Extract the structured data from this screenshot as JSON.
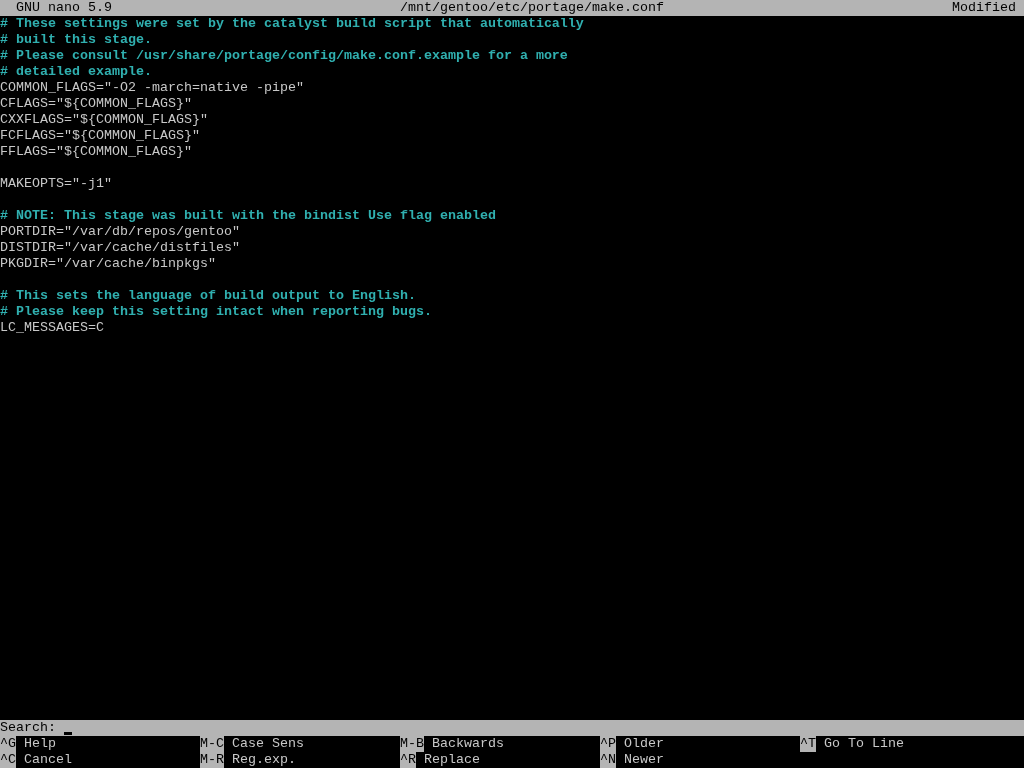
{
  "title_bar": {
    "app": "GNU nano 5.9",
    "file": "/mnt/gentoo/etc/portage/make.conf",
    "status": "Modified"
  },
  "lines": [
    {
      "kind": "comment",
      "text": "# These settings were set by the catalyst build script that automatically"
    },
    {
      "kind": "comment",
      "text": "# built this stage."
    },
    {
      "kind": "comment",
      "text": "# Please consult /usr/share/portage/config/make.conf.example for a more"
    },
    {
      "kind": "comment",
      "text": "# detailed example."
    },
    {
      "kind": "code",
      "text": "COMMON_FLAGS=\"-O2 -march=native -pipe\""
    },
    {
      "kind": "code",
      "text": "CFLAGS=\"${COMMON_FLAGS}\""
    },
    {
      "kind": "code",
      "text": "CXXFLAGS=\"${COMMON_FLAGS}\""
    },
    {
      "kind": "code",
      "text": "FCFLAGS=\"${COMMON_FLAGS}\""
    },
    {
      "kind": "code",
      "text": "FFLAGS=\"${COMMON_FLAGS}\""
    },
    {
      "kind": "blank"
    },
    {
      "kind": "code",
      "text": "MAKEOPTS=\"-j1\""
    },
    {
      "kind": "blank"
    },
    {
      "kind": "comment",
      "text": "# NOTE: This stage was built with the bindist Use flag enabled"
    },
    {
      "kind": "code",
      "text": "PORTDIR=\"/var/db/repos/gentoo\""
    },
    {
      "kind": "code",
      "text": "DISTDIR=\"/var/cache/distfiles\""
    },
    {
      "kind": "code",
      "text": "PKGDIR=\"/var/cache/binpkgs\""
    },
    {
      "kind": "blank"
    },
    {
      "kind": "comment",
      "text": "# This sets the language of build output to English."
    },
    {
      "kind": "comment",
      "text": "# Please keep this setting intact when reporting bugs."
    },
    {
      "kind": "code",
      "text": "LC_MESSAGES=C"
    }
  ],
  "prompt": {
    "label": "Search:"
  },
  "shortcuts": [
    {
      "key": "^G",
      "label": "Help"
    },
    {
      "key": "M-C",
      "label": "Case Sens"
    },
    {
      "key": "M-B",
      "label": "Backwards"
    },
    {
      "key": "^P",
      "label": "Older"
    },
    {
      "key": "^T",
      "label": "Go To Line"
    },
    {
      "key": "^C",
      "label": "Cancel"
    },
    {
      "key": "M-R",
      "label": "Reg.exp."
    },
    {
      "key": "^R",
      "label": "Replace"
    },
    {
      "key": "^N",
      "label": "Newer"
    }
  ]
}
